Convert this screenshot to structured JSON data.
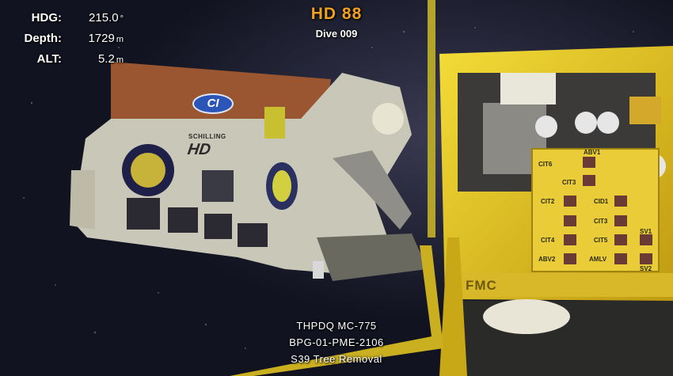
{
  "overlay": {
    "vehicle_name": "HD 88",
    "dive_label": "Dive 009",
    "telemetry": [
      {
        "label": "HDG:",
        "value": "215.0",
        "unit": "°"
      },
      {
        "label": "Depth:",
        "value": "1729",
        "unit": "m"
      },
      {
        "label": "ALT:",
        "value": "5.2",
        "unit": "m"
      }
    ],
    "caption_lines": [
      "THPDQ MC-775",
      "BPG-01-PME-2106",
      "S39 Tree Removal"
    ]
  },
  "scene": {
    "rov_logo_ci": "CI",
    "rov_logo_schilling": "SCHILLING",
    "rov_logo_hd": "HD",
    "tree_logo": "FMC",
    "valve_labels": [
      "ABV1",
      "CIT6",
      "CIT3",
      "CID1",
      "CIT2",
      "CIT3",
      "CIT4",
      "CIT5",
      "SV1",
      "ABV2",
      "AMLV",
      "SV2"
    ]
  },
  "colors": {
    "vehicle_name": "#f0a020",
    "tree_yellow": "#e8c020",
    "rov_frame": "#c8c6b8",
    "rov_top": "#a05a30",
    "water": "#121420"
  }
}
